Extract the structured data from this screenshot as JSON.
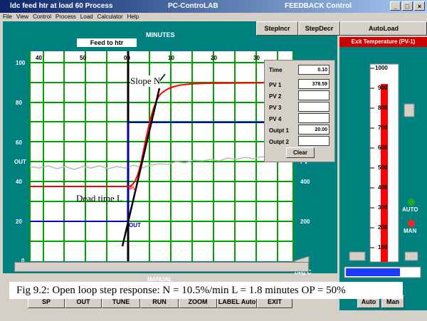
{
  "window": {
    "title_left": "ldc feed htr at load 60 Process",
    "title_center": "PC-ControLAB",
    "title_right": "FEEDBACK Control",
    "min": "_",
    "max": "□",
    "close": "×"
  },
  "menu": [
    "File",
    "View",
    "Control",
    "Process",
    "Load",
    "Calculator",
    "Help"
  ],
  "top_buttons": {
    "step_incr": "StepIncr",
    "step_decr": "StepDecr",
    "auto_load": "AutoLoad"
  },
  "chart_header": {
    "minutes": "MINUTES",
    "feed": "Feed to htr"
  },
  "x_ticks": [
    "40",
    "50",
    "00",
    "10",
    "20",
    "30"
  ],
  "y_left": [
    "100",
    "80",
    "60",
    "40",
    "20",
    "0"
  ],
  "y_right": [
    "400",
    "200"
  ],
  "left_out": "OUT",
  "right_pv": "PV",
  "annotations": {
    "slope": "Slope N",
    "dead_time": "Dead time L",
    "pv_tag": "PV",
    "out_tag": "OUT"
  },
  "popup": {
    "time_label": "Time",
    "time_value": "0.10",
    "pv1_label": "PV 1",
    "pv1_value": "378.59",
    "pv2_label": "PV 2",
    "pv3_label": "PV 3",
    "pv4_label": "PV 4",
    "outpt1_label": "Outpt 1",
    "outpt1_value": "20.00",
    "outpt2_label": "Outpt 2",
    "clear": "Clear"
  },
  "exit_header": "Exit Temperature  (PV-1)",
  "bar_scale": [
    "1000",
    "900",
    "800",
    "700",
    "600",
    "500",
    "400",
    "300",
    "200",
    "100"
  ],
  "auto_label": "AUTO",
  "man_label": "MAN",
  "deg_c": "Deg C",
  "manual_label": "MANUAL",
  "caption": "Fig 9.2: Open loop step response: N = 10.5%/min    L = 1.8 minutes OP = 50%",
  "bottom_buttons": [
    "SP",
    "OUT",
    "TUNE",
    "RUN",
    "ZOOM",
    "LABEL Auto",
    "EXIT"
  ],
  "auto_btn": "Auto",
  "man_btn": "Man",
  "colors": {
    "panel": "#00807f",
    "grid": "#00a000",
    "pv": "#ff0000",
    "out": "#0000cc",
    "noise": "#c0c0c0",
    "exit_header": "#cc0000"
  }
}
